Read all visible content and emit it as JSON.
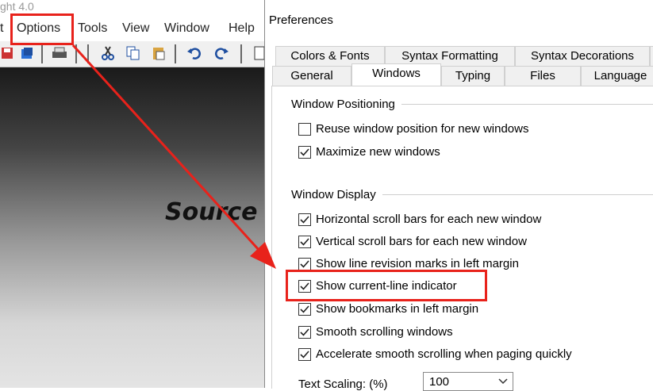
{
  "app": {
    "title_fragment": "ght 4.0",
    "menu": [
      "t",
      "Options",
      "Tools",
      "View",
      "Window",
      "Help"
    ],
    "editor_text": "Source"
  },
  "dialog": {
    "title": "Preferences",
    "tabs_row1": [
      "Colors & Fonts",
      "Syntax Formatting",
      "Syntax Decorations"
    ],
    "tabs_row2": [
      "General",
      "Windows",
      "Typing",
      "Files",
      "Language"
    ],
    "active_tab": "Windows",
    "group_positioning": {
      "label": "Window Positioning",
      "options": [
        {
          "label": "Reuse window position for new windows",
          "checked": false
        },
        {
          "label": "Maximize new windows",
          "checked": true
        }
      ]
    },
    "group_display": {
      "label": "Window Display",
      "options": [
        {
          "label": "Horizontal scroll bars for each new window",
          "checked": true
        },
        {
          "label": "Vertical scroll bars for each new window",
          "checked": true
        },
        {
          "label": "Show line revision marks in left margin",
          "checked": true
        },
        {
          "label": "Show current-line indicator",
          "checked": true
        },
        {
          "label": "Show bookmarks in left margin",
          "checked": true
        },
        {
          "label": "Smooth scrolling windows",
          "checked": true
        },
        {
          "label": "Accelerate smooth scrolling when paging quickly",
          "checked": true
        }
      ]
    },
    "text_scaling": {
      "label": "Text Scaling: (%)",
      "value": "100"
    }
  },
  "colors": {
    "highlight": "#e8221b"
  }
}
